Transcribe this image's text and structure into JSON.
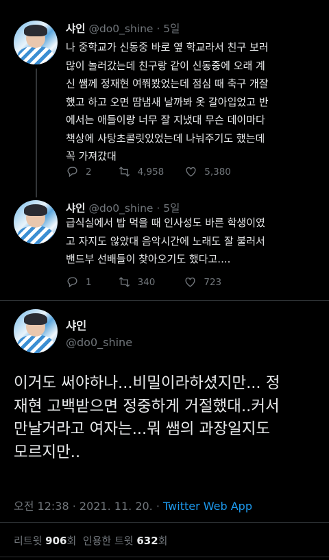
{
  "tweets": [
    {
      "name": "샤인",
      "handle": "@do0_shine",
      "sep": "·",
      "time": "5일",
      "text": "나 중학교가 신동중 바로 옆 학교라서 친구 보러\n많이 놀러갔는데 친구랑 같이 신동중에 오래 계\n신 쌤께 정재현 여쭤봤었는데 점심 때 축구 개잘\n했고 하고 오면 땀냄새 날까봐 옷 갈아입었고 반\n에서는 애들이랑 너무 잘 지냈대 무슨 데이마다\n책상에 사탕초콜릿있었는데 나눠주기도 했는데\n꼭 가져갔대",
      "replies": "2",
      "retweets": "4,958",
      "likes": "5,380"
    },
    {
      "name": "샤인",
      "handle": "@do0_shine",
      "sep": "·",
      "time": "5일",
      "text": "급식실에서 밥 먹을 때 인사성도 바른 학생이였\n고 자지도 않았대 음악시간에 노래도 잘 불러서\n밴드부 선배들이 찾아오기도 했다고....",
      "replies": "1",
      "retweets": "340",
      "likes": "723"
    }
  ],
  "main": {
    "name": "샤인",
    "handle": "@do0_shine",
    "text": "이거도 써야하나...비밀이라하셨지만... 정\n재현 고백받으면 정중하게 거절했대..커서\n만날거라고 여자는...뭐 쌤의 과장일지도\n모르지만..",
    "time": "오전 12:38 · 2021. 11. 20. · ",
    "app": "Twitter Web App",
    "retweet_label": "리트윗 ",
    "retweet_count": "906",
    "retweet_unit": "회  인용한 트윗 ",
    "quote_count": "632",
    "quote_unit": "회"
  },
  "colors": {
    "background": "#000000",
    "accent": "#1d9bf0",
    "muted": "#71767b",
    "text": "#e7e9ea"
  },
  "icons": [
    "reply-icon",
    "retweet-icon",
    "like-icon"
  ]
}
